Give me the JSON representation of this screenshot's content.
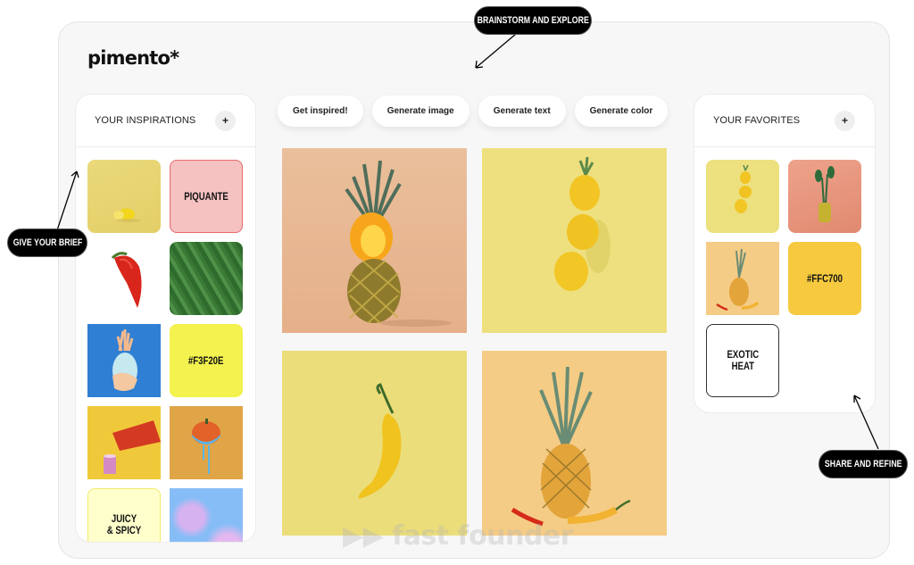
{
  "app": {
    "logo": "pimento*"
  },
  "inspirations": {
    "title": "YOUR INSPIRATIONS",
    "add_label": "+",
    "items": [
      {
        "kind": "image",
        "subject": "lemon on yellow background",
        "bg": "#e8d877"
      },
      {
        "kind": "text",
        "text": "PIQUANTE",
        "bg": "#f5c1c1",
        "border": "#e86b6b"
      },
      {
        "kind": "image",
        "subject": "red chili pepper",
        "bg": "#ffffff"
      },
      {
        "kind": "image",
        "subject": "green leaves texture",
        "bg": "#3d7a3a"
      },
      {
        "kind": "image",
        "subject": "pastel pineapple on blue",
        "bg": "#2f7fd4"
      },
      {
        "kind": "color",
        "text": "#F3F20E",
        "bg": "#f3f24e"
      },
      {
        "kind": "image",
        "subject": "red juice pack pouring into cup",
        "bg": "#f0c93a"
      },
      {
        "kind": "image",
        "subject": "pumpkin dipped in blue paint",
        "bg": "#e0a547"
      },
      {
        "kind": "text",
        "text": "JUICY\n& SPICY",
        "bg": "#ffffcc",
        "border": "#f3ea6a"
      },
      {
        "kind": "image",
        "subject": "holographic gradient",
        "bg": "#8cbcf5"
      }
    ]
  },
  "actions": [
    {
      "label": "Get inspired!"
    },
    {
      "label": "Generate image"
    },
    {
      "label": "Generate text"
    },
    {
      "label": "Generate color"
    }
  ],
  "generated": [
    {
      "subject": "pineapple with flame on peach background",
      "bg": "#e9b892"
    },
    {
      "subject": "stacked yellow pineapples on yellow background",
      "bg": "#ede07e"
    },
    {
      "subject": "yellow chili pepper on yellow background",
      "bg": "#ebdd7a"
    },
    {
      "subject": "pineapple with chili peppers on orange background",
      "bg": "#f4cb82"
    }
  ],
  "favorites": {
    "title": "YOUR FAVORITES",
    "add_label": "+",
    "items": [
      {
        "kind": "image",
        "subject": "stacked yellow pineapples",
        "bg": "#ede07e"
      },
      {
        "kind": "image",
        "subject": "yellow pepper with leaves on salmon",
        "bg": "#e59a80"
      },
      {
        "kind": "image",
        "subject": "pineapple with chili peppers",
        "bg": "#f4cb82"
      },
      {
        "kind": "color",
        "text": "#FFC700",
        "bg": "#f6c93f"
      },
      {
        "kind": "text",
        "text": "EXOTIC\nHEAT",
        "bg": "#ffffff",
        "border": "#333333"
      }
    ]
  },
  "annotations": {
    "brainstorm": "BRAINSTORM AND EXPLORE",
    "brief": "GIVE YOUR BRIEF",
    "share": "SHARE AND REFINE"
  },
  "watermark": "▶▶ fast founder"
}
